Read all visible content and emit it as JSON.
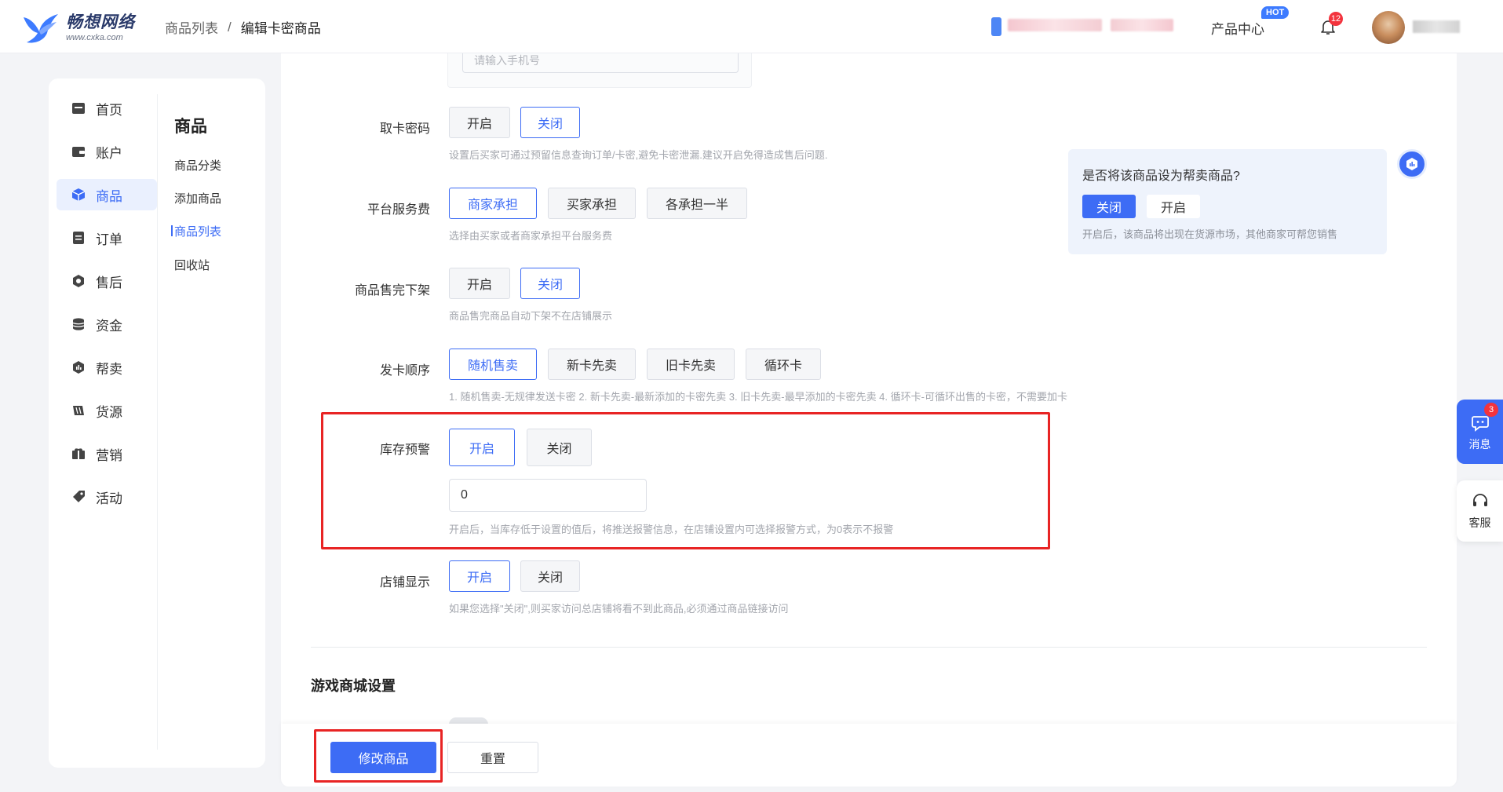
{
  "brand": {
    "name": "畅想网络",
    "url": "www.cxka.com"
  },
  "breadcrumb": {
    "parent": "商品列表",
    "separator": "/",
    "current": "编辑卡密商品"
  },
  "header": {
    "product_center": "产品中心",
    "hot_badge": "HOT",
    "notifications": "12"
  },
  "nav": {
    "items": [
      {
        "label": "首页",
        "icon": "home-icon"
      },
      {
        "label": "账户",
        "icon": "wallet-icon"
      },
      {
        "label": "商品",
        "icon": "box-icon",
        "active": true
      },
      {
        "label": "订单",
        "icon": "order-icon"
      },
      {
        "label": "售后",
        "icon": "aftersale-icon"
      },
      {
        "label": "资金",
        "icon": "coins-icon"
      },
      {
        "label": "帮卖",
        "icon": "help-sell-icon"
      },
      {
        "label": "货源",
        "icon": "supply-icon"
      },
      {
        "label": "营销",
        "icon": "marketing-icon"
      },
      {
        "label": "活动",
        "icon": "activity-icon"
      }
    ]
  },
  "subnav": {
    "title": "商品",
    "items": [
      {
        "label": "商品分类"
      },
      {
        "label": "添加商品"
      },
      {
        "label": "商品列表",
        "active": true
      },
      {
        "label": "回收站"
      }
    ]
  },
  "form": {
    "phone_placeholder": "请输入手机号",
    "card_password": {
      "label": "取卡密码",
      "options": [
        "开启",
        "关闭"
      ],
      "selected": "关闭",
      "hint": "设置后买家可通过预留信息查询订单/卡密,避免卡密泄漏.建议开启免得造成售后问题."
    },
    "platform_fee": {
      "label": "平台服务费",
      "options": [
        "商家承担",
        "买家承担",
        "各承担一半"
      ],
      "selected": "商家承担",
      "hint": "选择由买家或者商家承担平台服务费"
    },
    "soldout_offshelf": {
      "label": "商品售完下架",
      "options": [
        "开启",
        "关闭"
      ],
      "selected": "关闭",
      "hint": "商品售完商品自动下架不在店铺展示"
    },
    "issue_order": {
      "label": "发卡顺序",
      "options": [
        "随机售卖",
        "新卡先卖",
        "旧卡先卖",
        "循环卡"
      ],
      "selected": "随机售卖",
      "hint": "1. 随机售卖-无规律发送卡密 2. 新卡先卖-最新添加的卡密先卖 3. 旧卡先卖-最早添加的卡密先卖 4. 循环卡-可循环出售的卡密，不需要加卡"
    },
    "stock_alert": {
      "label": "库存预警",
      "options": [
        "开启",
        "关闭"
      ],
      "selected": "开启",
      "value": "0",
      "hint": "开启后，当库存低于设置的值后，将推送报警信息，在店铺设置内可选择报警方式，为0表示不报警"
    },
    "shop_display": {
      "label": "店铺显示",
      "options": [
        "开启",
        "关闭"
      ],
      "selected": "开启",
      "hint": "如果您选择\"关闭\",则买家访问总店铺将看不到此商品,必须通过商品链接访问"
    },
    "game_section_title": "游戏商城设置",
    "submit_label": "修改商品",
    "reset_label": "重置"
  },
  "help_sell": {
    "question": "是否将该商品设为帮卖商品?",
    "options": [
      "关闭",
      "开启"
    ],
    "selected": "关闭",
    "hint": "开启后，该商品将出现在货源市场，其他商家可帮您销售"
  },
  "float": {
    "message_label": "消息",
    "message_count": "3",
    "service_label": "客服"
  },
  "colors": {
    "accent": "#3d6cf5",
    "highlight": "#e82424",
    "badge": "#f3333d"
  }
}
